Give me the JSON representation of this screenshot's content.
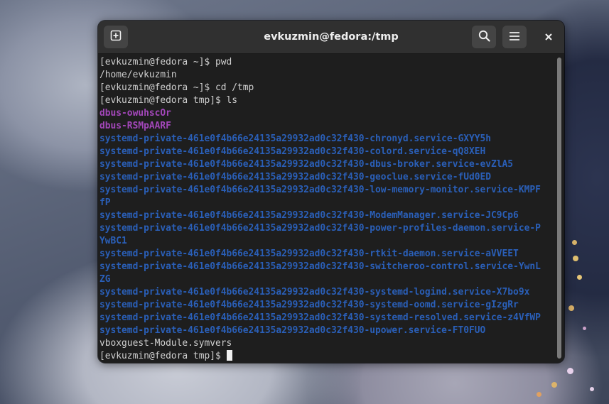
{
  "window": {
    "title": "evkuzmin@fedora:/tmp",
    "buttons": {
      "new_tab_icon": "new-tab-icon",
      "search_icon": "search-icon",
      "menu_icon": "hamburger-menu-icon",
      "close_icon": "close-icon"
    }
  },
  "terminal": {
    "colors": {
      "background": "#1e1e1e",
      "text": "#d0d0d0",
      "directory": "#a347ba",
      "sticky_dir": "#2a5fb8"
    },
    "lines": [
      {
        "text": "[evkuzmin@fedora ~]$ pwd",
        "kind": "normal"
      },
      {
        "text": "/home/evkuzmin",
        "kind": "normal"
      },
      {
        "text": "[evkuzmin@fedora ~]$ cd /tmp",
        "kind": "normal"
      },
      {
        "text": "[evkuzmin@fedora tmp]$ ls",
        "kind": "normal"
      },
      {
        "text": "dbus-owuhscOr",
        "kind": "dir"
      },
      {
        "text": "dbus-RSMpAARF",
        "kind": "dir"
      },
      {
        "text": "systemd-private-461e0f4b66e24135a29932ad0c32f430-chronyd.service-GXYY5h",
        "kind": "sys"
      },
      {
        "text": "systemd-private-461e0f4b66e24135a29932ad0c32f430-colord.service-qQ8XEH",
        "kind": "sys"
      },
      {
        "text": "systemd-private-461e0f4b66e24135a29932ad0c32f430-dbus-broker.service-evZlA5",
        "kind": "sys"
      },
      {
        "text": "systemd-private-461e0f4b66e24135a29932ad0c32f430-geoclue.service-fUd0ED",
        "kind": "sys"
      },
      {
        "text": "systemd-private-461e0f4b66e24135a29932ad0c32f430-low-memory-monitor.service-KMPF",
        "kind": "sys"
      },
      {
        "text": "fP",
        "kind": "sys"
      },
      {
        "text": "systemd-private-461e0f4b66e24135a29932ad0c32f430-ModemManager.service-JC9Cp6",
        "kind": "sys"
      },
      {
        "text": "systemd-private-461e0f4b66e24135a29932ad0c32f430-power-profiles-daemon.service-P",
        "kind": "sys"
      },
      {
        "text": "YwBC1",
        "kind": "sys"
      },
      {
        "text": "systemd-private-461e0f4b66e24135a29932ad0c32f430-rtkit-daemon.service-aVVEET",
        "kind": "sys"
      },
      {
        "text": "systemd-private-461e0f4b66e24135a29932ad0c32f430-switcheroo-control.service-YwnL",
        "kind": "sys"
      },
      {
        "text": "ZG",
        "kind": "sys"
      },
      {
        "text": "systemd-private-461e0f4b66e24135a29932ad0c32f430-systemd-logind.service-X7bo9x",
        "kind": "sys"
      },
      {
        "text": "systemd-private-461e0f4b66e24135a29932ad0c32f430-systemd-oomd.service-gIzgRr",
        "kind": "sys"
      },
      {
        "text": "systemd-private-461e0f4b66e24135a29932ad0c32f430-systemd-resolved.service-z4VfWP",
        "kind": "sys"
      },
      {
        "text": "systemd-private-461e0f4b66e24135a29932ad0c32f430-upower.service-FT0FUO",
        "kind": "sys"
      },
      {
        "text": "vboxguest-Module.symvers",
        "kind": "normal"
      }
    ],
    "prompt": "[evkuzmin@fedora tmp]$ "
  }
}
